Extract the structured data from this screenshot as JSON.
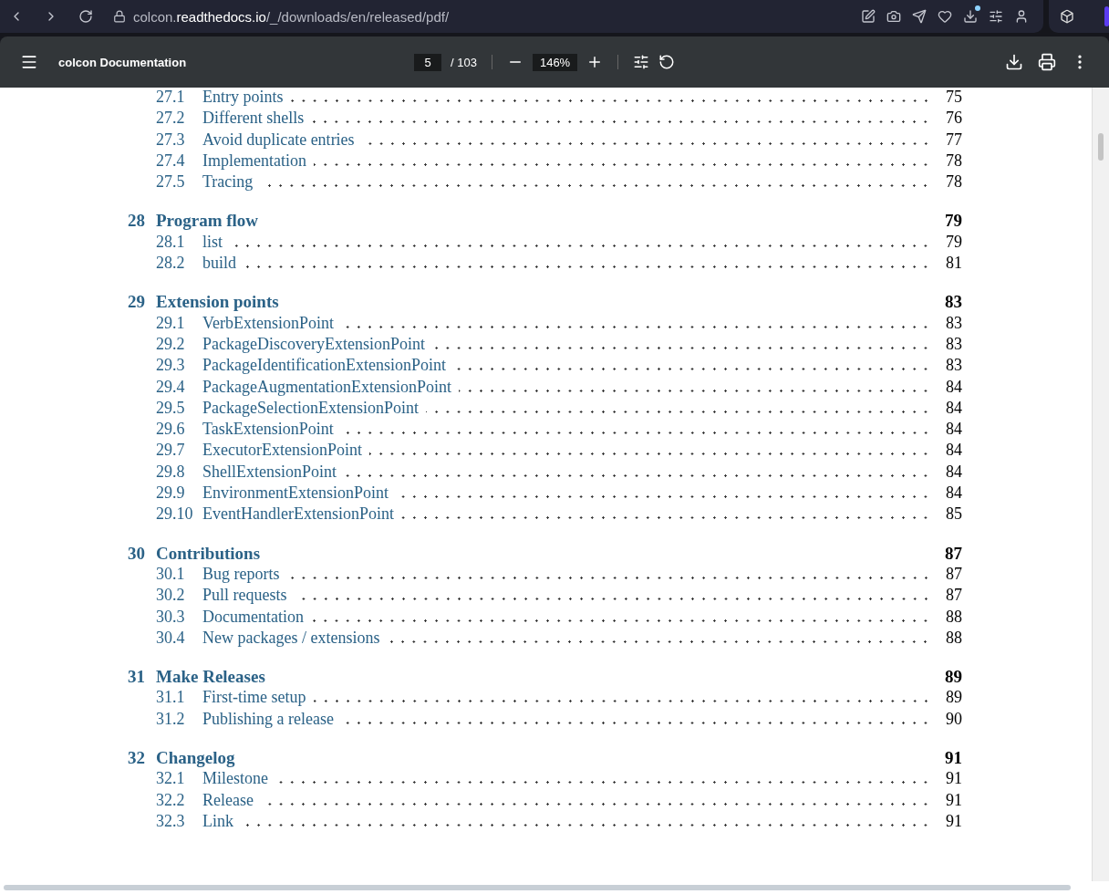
{
  "browser": {
    "url_parts": [
      {
        "text": "colcon.",
        "emphasis": false
      },
      {
        "text": "readthedocs.io",
        "emphasis": true
      },
      {
        "text": "/_/downloads/en/released/pdf/",
        "emphasis": false
      }
    ],
    "download_badge": true
  },
  "viewer": {
    "title": "colcon Documentation",
    "page": "5",
    "page_total": "/ 103",
    "zoom": "146%"
  },
  "toc": [
    {
      "sections": [
        {
          "number": "27.1",
          "title": "Entry points",
          "page": "75"
        },
        {
          "number": "27.2",
          "title": "Different shells",
          "page": "76"
        },
        {
          "number": "27.3",
          "title": "Avoid duplicate entries",
          "page": "77"
        },
        {
          "number": "27.4",
          "title": "Implementation",
          "page": "78"
        },
        {
          "number": "27.5",
          "title": "Tracing",
          "page": "78"
        }
      ]
    },
    {
      "number": "28",
      "title": "Program flow",
      "page": "79",
      "sections": [
        {
          "number": "28.1",
          "title": "list",
          "page": "79"
        },
        {
          "number": "28.2",
          "title": "build",
          "page": "81"
        }
      ]
    },
    {
      "number": "29",
      "title": "Extension points",
      "page": "83",
      "sections": [
        {
          "number": "29.1",
          "title": "VerbExtensionPoint",
          "page": "83"
        },
        {
          "number": "29.2",
          "title": "PackageDiscoveryExtensionPoint",
          "page": "83"
        },
        {
          "number": "29.3",
          "title": "PackageIdentificationExtensionPoint",
          "page": "83"
        },
        {
          "number": "29.4",
          "title": "PackageAugmentationExtensionPoint",
          "page": "84"
        },
        {
          "number": "29.5",
          "title": "PackageSelectionExtensionPoint",
          "page": "84"
        },
        {
          "number": "29.6",
          "title": "TaskExtensionPoint",
          "page": "84"
        },
        {
          "number": "29.7",
          "title": "ExecutorExtensionPoint",
          "page": "84"
        },
        {
          "number": "29.8",
          "title": "ShellExtensionPoint",
          "page": "84"
        },
        {
          "number": "29.9",
          "title": "EnvironmentExtensionPoint",
          "page": "84"
        },
        {
          "number": "29.10",
          "title": "EventHandlerExtensionPoint",
          "page": "85"
        }
      ]
    },
    {
      "number": "30",
      "title": "Contributions",
      "page": "87",
      "sections": [
        {
          "number": "30.1",
          "title": "Bug reports",
          "page": "87"
        },
        {
          "number": "30.2",
          "title": "Pull requests",
          "page": "87"
        },
        {
          "number": "30.3",
          "title": "Documentation",
          "page": "88"
        },
        {
          "number": "30.4",
          "title": "New packages / extensions",
          "page": "88"
        }
      ]
    },
    {
      "number": "31",
      "title": "Make Releases",
      "page": "89",
      "sections": [
        {
          "number": "31.1",
          "title": "First-time setup",
          "page": "89"
        },
        {
          "number": "31.2",
          "title": "Publishing a release",
          "page": "90"
        }
      ]
    },
    {
      "number": "32",
      "title": "Changelog",
      "page": "91",
      "sections": [
        {
          "number": "32.1",
          "title": "Milestone",
          "page": "91"
        },
        {
          "number": "32.2",
          "title": "Release",
          "page": "91"
        },
        {
          "number": "32.3",
          "title": "Link",
          "page": "91"
        }
      ]
    }
  ]
}
